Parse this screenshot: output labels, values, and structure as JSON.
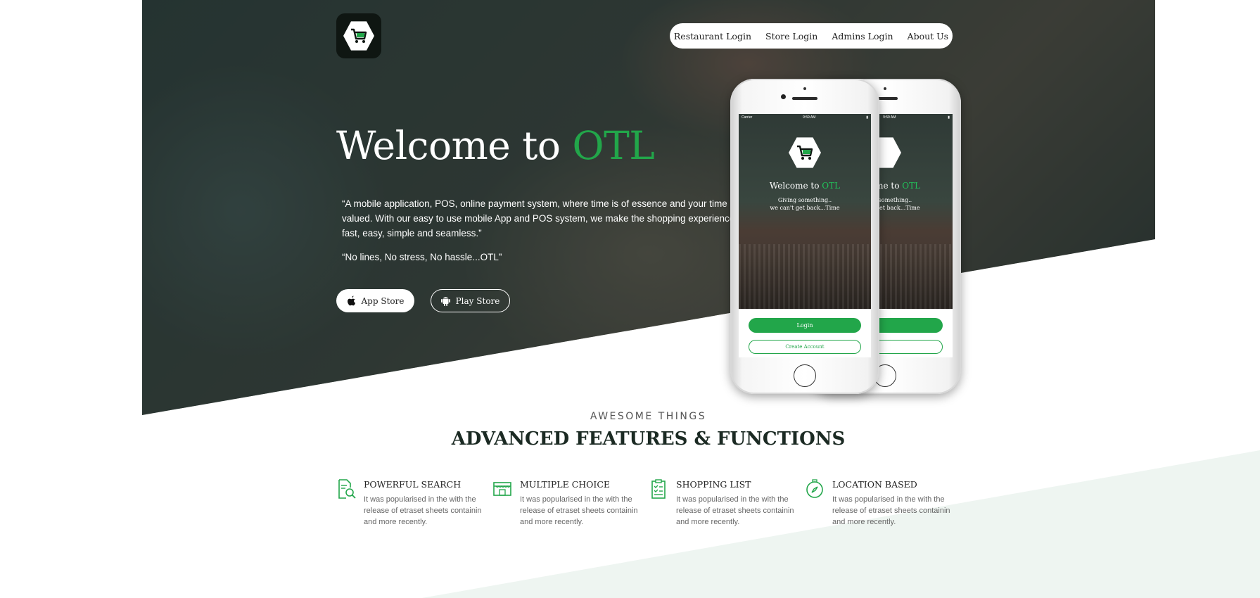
{
  "brand": {
    "logo_icon": "shopping-cart-icon"
  },
  "nav": {
    "items": [
      "Restaurant Login",
      "Store Login",
      "Admins Login",
      "About Us"
    ]
  },
  "hero": {
    "headline_prefix": "Welcome to ",
    "headline_accent": "OTL",
    "description": "“A mobile application, POS, online payment system, where time is of essence and your time is valued. With our easy to use mobile App and POS system, we make the shopping experience fast, easy, simple and seamless.”",
    "motto": "“No lines, No stress, No hassle...OTL”",
    "app_store_label": "App Store",
    "play_store_label": "Play Store"
  },
  "phone": {
    "carrier": "Carrier",
    "time": "9:59 AM",
    "title_prefix": "Welcome to ",
    "title_accent": "OTL",
    "subtitle": "Giving something..\nwe can't get back...Time",
    "login_label": "Login",
    "create_label": "Create Account"
  },
  "features_section": {
    "kicker": "AWESOME THINGS",
    "title": "ADVANCED FEATURES & FUNCTIONS",
    "items": [
      {
        "title": "POWERFUL SEARCH",
        "text": "It was popularised in the with the release of etraset sheets containin and more recently.",
        "icon": "document-search-icon"
      },
      {
        "title": "MULTIPLE CHOICE",
        "text": "It was popularised in the with the release of etraset sheets containin and more recently.",
        "icon": "storefront-icon"
      },
      {
        "title": "SHOPPING LIST",
        "text": "It was popularised in the with the release of etraset sheets containin and more recently.",
        "icon": "clipboard-list-icon"
      },
      {
        "title": "LOCATION BASED",
        "text": "It was popularised in the with the release of etraset sheets containin and more recently.",
        "icon": "compass-icon"
      }
    ]
  },
  "colors": {
    "accent": "#22a64a",
    "logo_bg": "#0f1612",
    "wave": "#eef5f1"
  }
}
